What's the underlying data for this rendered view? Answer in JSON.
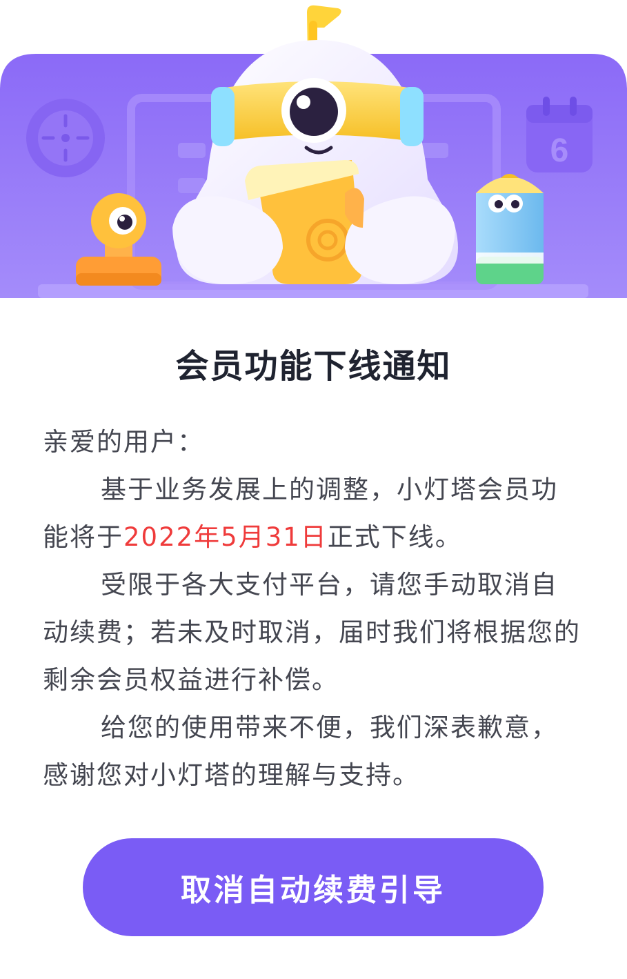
{
  "banner": {
    "calendar_day": "6",
    "colors": {
      "bg_top": "#8b6af7",
      "bg_bottom": "#a48cfa",
      "robot": "#f4f1ff",
      "visor": "#f7c92e",
      "accent_orange": "#fba23a",
      "pencil_blue": "#7fc8f5",
      "pencil_green": "#5ed38a"
    }
  },
  "notice": {
    "title": "会员功能下线通知",
    "greeting": "亲爱的用户：",
    "para1_before": "基于业务发展上的调整，小灯塔会员功能将于",
    "para1_date": "2022年5月31日",
    "para1_after": "正式下线。",
    "para2": "受限于各大支付平台，请您手动取消自动续费；若未及时取消，届时我们将根据您的剩余会员权益进行补偿。",
    "para3": "给您的使用带来不便，我们深表歉意，感谢您对小灯塔的理解与支持。",
    "highlight_color": "#ef3b3b"
  },
  "action": {
    "button_label": "取消自动续费引导",
    "button_color": "#7a5cf5"
  }
}
